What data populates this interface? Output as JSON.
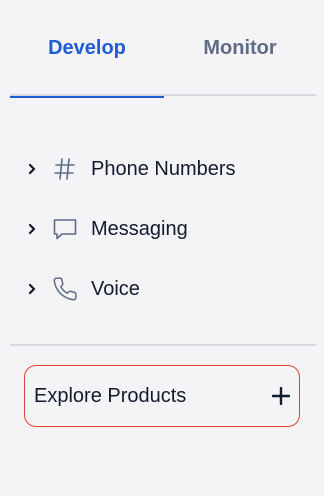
{
  "tabs": {
    "develop": "Develop",
    "monitor": "Monitor",
    "active": "Develop"
  },
  "nav": {
    "items": [
      {
        "label": "Phone Numbers",
        "icon": "hash-icon"
      },
      {
        "label": "Messaging",
        "icon": "chat-bubble-icon"
      },
      {
        "label": "Voice",
        "icon": "phone-icon"
      }
    ]
  },
  "explore": {
    "label": "Explore Products",
    "icon": "plus-icon"
  },
  "colors": {
    "accent": "#1f5cd6",
    "highlight_border": "#e0432f",
    "muted_text": "#606b85",
    "text": "#121c2d",
    "divider": "#d5d9e2",
    "background": "#f4f4f6"
  }
}
